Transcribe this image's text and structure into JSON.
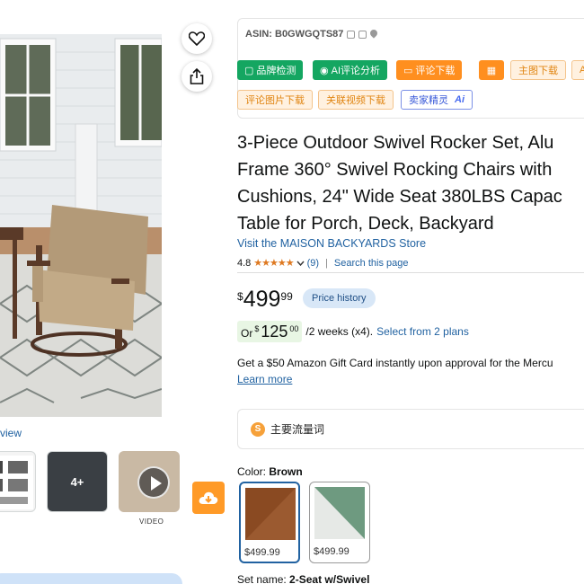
{
  "gallery": {
    "view_link": "view",
    "more_count": "4+",
    "video_label": "VIDEO"
  },
  "plugin": {
    "asin_label": "ASIN: B0GWGQTS87",
    "buttons": {
      "brand_check": "品牌检测",
      "ai_review": "AI评论分析",
      "review_download": "评论下载",
      "main_image_download": "主图下载",
      "review_image_download": "评论图片下载",
      "related_video_download": "关联视频下载",
      "seller_genie": "卖家精灵",
      "seller_genie_ai": "Ai"
    }
  },
  "product": {
    "title_lines": [
      "3-Piece Outdoor Swivel Rocker Set, Alu",
      "Frame 360° Swivel Rocking Chairs with",
      "Cushions, 24\" Wide Seat 380LBS Capac",
      "Table for Porch, Deck, Backyard"
    ],
    "store_link": "Visit the MAISON BACKYARDS Store",
    "rating": "4.8",
    "stars": "★★★★★",
    "rating_count": "(9)",
    "rating_separator": "|",
    "search_page": "Search this page"
  },
  "price": {
    "currency": "$",
    "whole": "499",
    "fraction": "99",
    "history_label": "Price history"
  },
  "plan": {
    "or": "Or",
    "currency": "$",
    "whole": "125",
    "fraction": "00",
    "terms": "/2 weeks (x4).",
    "select_link": "Select from 2 plans"
  },
  "gift": {
    "text": "Get a $50 Amazon Gift Card instantly upon approval for the Mercu",
    "learn_more": "Learn more"
  },
  "keywords": {
    "icon_glyph": "S",
    "label": "主要流量词"
  },
  "variants": {
    "color_label": "Color:",
    "color_value": "Brown",
    "swatches": [
      {
        "price": "$499.99",
        "color": "#8a4a22"
      },
      {
        "price": "$499.99",
        "color": "#6e9a80"
      }
    ],
    "set_label": "Set name:",
    "set_value": "2-Seat w/Swivel"
  },
  "colors": {
    "link": "#2162a1",
    "star": "#de7921",
    "green_button": "#14a661",
    "orange_button": "#ff8f1f",
    "price_history_bg": "#d8e7f7"
  },
  "icons": {
    "heart": "heart-icon",
    "share": "share-icon",
    "cloud": "cloud-download-icon",
    "play": "play-icon"
  }
}
